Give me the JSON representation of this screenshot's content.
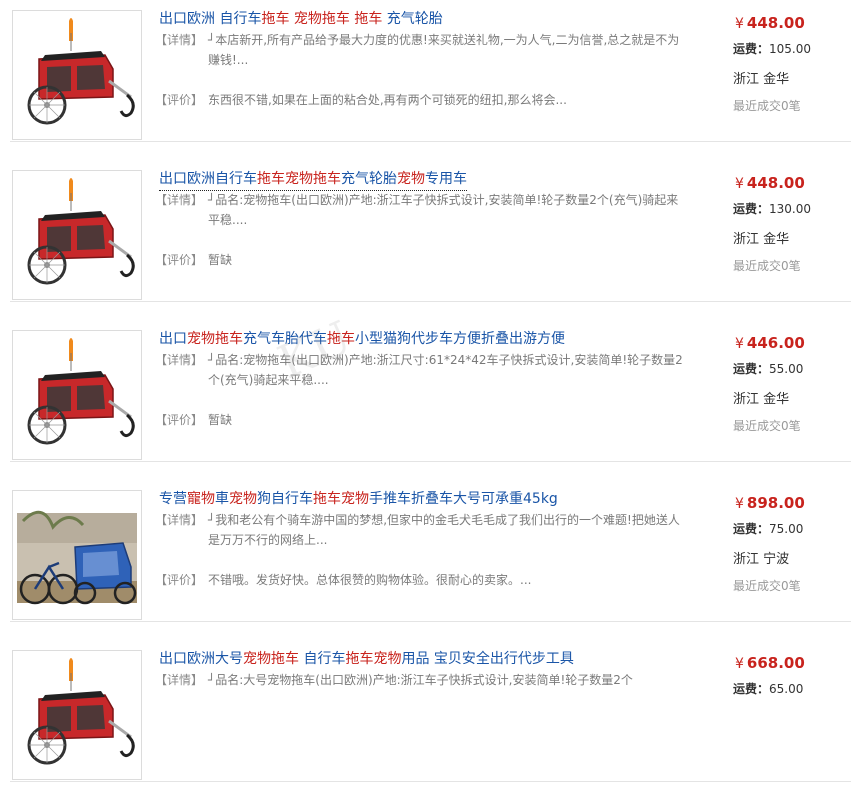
{
  "labels": {
    "detail": "【详情】",
    "review": "【评价】",
    "currency": "¥",
    "shipping": "运费："
  },
  "items": [
    {
      "title_parts": [
        {
          "t": "出口欧洲 自行车",
          "hl": false
        },
        {
          "t": "拖车",
          "hl": true
        },
        {
          "t": " ",
          "hl": false
        },
        {
          "t": "宠物拖车",
          "hl": true
        },
        {
          "t": " ",
          "hl": false
        },
        {
          "t": "拖车",
          "hl": true
        },
        {
          "t": " 充气轮胎",
          "hl": false
        }
      ],
      "detail": "┘本店新开,所有产品给予最大力度的优惠!来买就送礼物,一为人气,二为信誉,总之就是不为赚钱!...",
      "review": "东西很不错,如果在上面的粘合处,再有两个可锁死的纽扣,那么将会...",
      "price": "448.00",
      "shipping": "105.00",
      "location": "浙江 金华",
      "recent": "最近成交0笔",
      "thumb": "red-trailer"
    },
    {
      "title_parts": [
        {
          "t": "出口欧洲自行车",
          "hl": false
        },
        {
          "t": "拖车宠物拖车",
          "hl": true
        },
        {
          "t": "充气轮胎",
          "hl": false
        },
        {
          "t": "宠物",
          "hl": true
        },
        {
          "t": "专用车",
          "hl": false
        }
      ],
      "detail": "┘品名:宠物拖车(出口欧洲)产地:浙江车子快拆式设计,安装简单!轮子数量2个(充气)骑起来平稳....",
      "review": "暂缺",
      "price": "448.00",
      "shipping": "130.00",
      "location": "浙江 金华",
      "recent": "最近成交0笔",
      "thumb": "red-trailer"
    },
    {
      "title_parts": [
        {
          "t": "出口",
          "hl": false
        },
        {
          "t": "宠物拖车",
          "hl": true
        },
        {
          "t": "充气车胎代车",
          "hl": false
        },
        {
          "t": "拖车",
          "hl": true
        },
        {
          "t": "小型猫狗代步车方便折叠出游方便",
          "hl": false
        }
      ],
      "detail": "┘品名:宠物拖车(出口欧洲)产地:浙江尺寸:61*24*42车子快拆式设计,安装简单!轮子数量2个(充气)骑起来平稳....",
      "review": "暂缺",
      "price": "446.00",
      "shipping": "55.00",
      "location": "浙江 金华",
      "recent": "最近成交0笔",
      "thumb": "red-trailer"
    },
    {
      "title_parts": [
        {
          "t": "专营",
          "hl": false
        },
        {
          "t": "寵物",
          "hl": true
        },
        {
          "t": "車",
          "hl": false
        },
        {
          "t": "宠物",
          "hl": true
        },
        {
          "t": "狗自行车",
          "hl": false
        },
        {
          "t": "拖车宠物",
          "hl": true
        },
        {
          "t": "手推车折叠车大号可承重45kg",
          "hl": false
        }
      ],
      "detail": "┘我和老公有个骑车游中国的梦想,但家中的金毛犬毛毛成了我们出行的一个难题!把她送人是万万不行的网络上...",
      "review": "不错哦。发货好快。总体很赞的购物体验。很耐心的卖家。...",
      "price": "898.00",
      "shipping": "75.00",
      "location": "浙江 宁波",
      "recent": "最近成交0笔",
      "thumb": "blue-trailer"
    },
    {
      "title_parts": [
        {
          "t": "出口欧洲大号",
          "hl": false
        },
        {
          "t": "宠物拖车",
          "hl": true
        },
        {
          "t": " 自行车",
          "hl": false
        },
        {
          "t": "拖车宠物",
          "hl": true
        },
        {
          "t": "用品 宝贝安全出行代步工具",
          "hl": false
        }
      ],
      "detail": "┘品名:大号宠物拖车(出口欧洲)产地:浙江车子快拆式设计,安装简单!轮子数量2个",
      "review": "",
      "price": "668.00",
      "shipping": "65.00",
      "location": "",
      "recent": "",
      "thumb": "red-trailer"
    }
  ]
}
